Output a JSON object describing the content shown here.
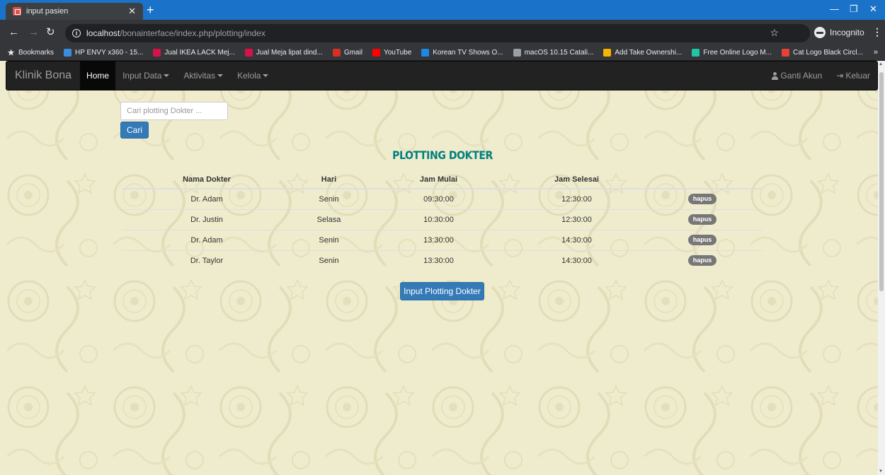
{
  "browser": {
    "tab_title": "input pasien",
    "url_host": "localhost",
    "url_path": "/bonainterface/index.php/plotting/index",
    "incognito_label": "Incognito",
    "bookmarks": [
      {
        "label": "Bookmarks",
        "icon": "star-icon",
        "color": "#e8eaed"
      },
      {
        "label": "HP ENVY x360 - 15...",
        "icon": "hp-icon",
        "color": "#3b8ede"
      },
      {
        "label": "Jual IKEA LACK Mej...",
        "icon": "bukalapak-icon",
        "color": "#d71149"
      },
      {
        "label": "Jual Meja lipat dind...",
        "icon": "bukalapak-icon",
        "color": "#d71149"
      },
      {
        "label": "Gmail",
        "icon": "gmail-icon",
        "color": "#d93025"
      },
      {
        "label": "YouTube",
        "icon": "youtube-icon",
        "color": "#ff0000"
      },
      {
        "label": "Korean TV Shows O...",
        "icon": "k-icon",
        "color": "#1e88e5"
      },
      {
        "label": "macOS 10.15 Catali...",
        "icon": "globe-icon",
        "color": "#9aa0a6"
      },
      {
        "label": "Add Take Ownershi...",
        "icon": "windows-icon",
        "color": "#f4b400"
      },
      {
        "label": "Free Online Logo M...",
        "icon": "logo-maker-icon",
        "color": "#1ec8a5"
      },
      {
        "label": "Cat Logo Black Circl...",
        "icon": "cat-logo-icon",
        "color": "#e94235"
      }
    ]
  },
  "navbar": {
    "brand": "Klinik Bona",
    "items": [
      {
        "label": "Home",
        "active": true,
        "dropdown": false
      },
      {
        "label": "Input Data",
        "active": false,
        "dropdown": true
      },
      {
        "label": "Aktivitas",
        "active": false,
        "dropdown": true
      },
      {
        "label": "Kelola",
        "active": false,
        "dropdown": true
      }
    ],
    "account_label": "Ganti Akun",
    "logout_label": "Keluar"
  },
  "search": {
    "placeholder": "Cari plotting Dokter ...",
    "button_label": "Cari"
  },
  "page_title": "PLOTTING DOKTER",
  "table": {
    "headers": [
      "Nama Dokter",
      "Hari",
      "Jam Mulai",
      "Jam Selesai",
      ""
    ],
    "rows": [
      {
        "nama": "Dr. Adam",
        "hari": "Senin",
        "mulai": "09:30:00",
        "selesai": "12:30:00",
        "action": "hapus"
      },
      {
        "nama": "Dr. Justin",
        "hari": "Selasa",
        "mulai": "10:30:00",
        "selesai": "12:30:00",
        "action": "hapus"
      },
      {
        "nama": "Dr. Adam",
        "hari": "Senin",
        "mulai": "13:30:00",
        "selesai": "14:30:00",
        "action": "hapus"
      },
      {
        "nama": "Dr. Taylor",
        "hari": "Senin",
        "mulai": "13:30:00",
        "selesai": "14:30:00",
        "action": "hapus"
      }
    ]
  },
  "input_button_label": "Input Plotting Dokter",
  "colors": {
    "accent": "#337ab7",
    "title": "#008080",
    "page_background": "#efeccd",
    "navbar": "#222222",
    "badge": "#777777"
  }
}
